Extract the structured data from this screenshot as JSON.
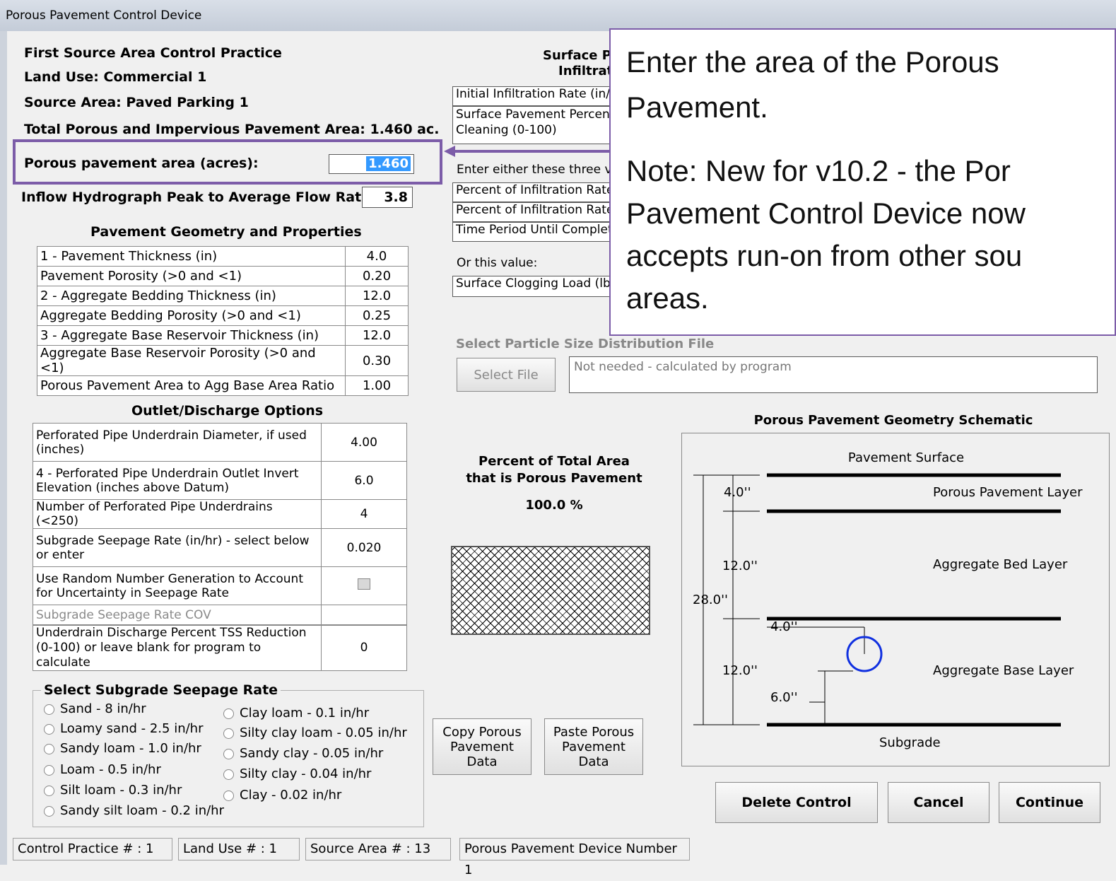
{
  "window": {
    "title": "Porous Pavement Control Device"
  },
  "header": {
    "control_practice": "First Source Area Control Practice",
    "land_use": "Land Use:  Commercial 1",
    "source_area": "Source Area:  Paved Parking 1",
    "total_area": "Total Porous and Impervious Pavement Area:  1.460 ac.",
    "porous_area_label": "Porous pavement area (acres):",
    "porous_area_value": "1.460",
    "inflow_label": "Inflow Hydrograph Peak to Average Flow Ratio",
    "inflow_value": "3.8"
  },
  "geometry": {
    "heading": "Pavement Geometry and Properties",
    "rows": [
      {
        "label": "1 - Pavement Thickness (in)",
        "value": "4.0"
      },
      {
        "label": "Pavement Porosity (>0 and <1)",
        "value": "0.20"
      },
      {
        "label": "2 - Aggregate Bedding Thickness (in)",
        "value": "12.0"
      },
      {
        "label": "Aggregate Bedding Porosity (>0 and <1)",
        "value": "0.25"
      },
      {
        "label": "3 - Aggregate Base Reservoir Thickness (in)",
        "value": "12.0"
      },
      {
        "label": "Aggregate Base Reservoir Porosity  (>0 and <1)",
        "value": "0.30"
      },
      {
        "label": "Porous Pavement Area to Agg Base Area Ratio",
        "value": "1.00"
      }
    ]
  },
  "outlet": {
    "heading": "Outlet/Discharge Options",
    "rows": [
      {
        "label": "Perforated Pipe Underdrain Diameter, if used (inches)",
        "value": "4.00"
      },
      {
        "label": "4 - Perforated Pipe Underdrain Outlet Invert Elevation (inches above Datum)",
        "value": "6.0"
      },
      {
        "label": "Number of Perforated Pipe Underdrains (<250)",
        "value": "4"
      },
      {
        "label": "Subgrade Seepage Rate (in/hr) - select below or enter",
        "value": "0.020"
      },
      {
        "label": "Use Random Number Generation to Account for Uncertainty in Seepage Rate",
        "value": ""
      },
      {
        "label": "Subgrade Seepage Rate COV",
        "value": ""
      }
    ],
    "tss_label": "Underdrain Discharge Percent TSS Reduction (0-100) or leave blank for program to calculate",
    "tss_value": "0"
  },
  "seepage": {
    "heading": "Select Subgrade Seepage Rate",
    "left": [
      "Sand - 8 in/hr",
      "Loamy sand - 2.5 in/hr",
      "Sandy loam - 1.0 in/hr",
      "Loam - 0.5 in/hr",
      "Silt loam - 0.3 in/hr",
      "Sandy silt loam - 0.2 in/hr"
    ],
    "right": [
      "Clay loam - 0.1 in/hr",
      "Silty clay loam - 0.05 in/hr",
      "Sandy clay - 0.05 in/hr",
      "Silty clay - 0.04 in/hr",
      "Clay - 0.02 in/hr"
    ]
  },
  "surface": {
    "heading1": "Surface P",
    "heading2": "Infiltrat",
    "row1": "Initial Infiltration Rate (in/h",
    "row2": "Surface Pavement Percen Cleaning (0-100)",
    "either": "Enter either these three va",
    "e1": "Percent of Infiltration Rate",
    "e2": "Percent of Infiltration Rate",
    "e3": "Time Period Until Complet",
    "or": "Or this value:",
    "clog": "Surface Clogging Load (lb"
  },
  "particle": {
    "heading": "Select Particle Size Distribution File",
    "button": "Select File",
    "file": "Not needed - calculated by program"
  },
  "percent": {
    "line1": "Percent of Total Area",
    "line2": "that is Porous Pavement",
    "value": "100.0 %"
  },
  "copy_button": "Copy Porous Pavement Data",
  "paste_button": "Paste Porous Pavement Data",
  "schematic": {
    "title": "Porous Pavement Geometry  Schematic",
    "surface": "Pavement Surface",
    "layer1": "Porous Pavement Layer",
    "layer2": "Aggregate Bed Layer",
    "layer3": "Aggregate Base Layer",
    "subgrade": "Subgrade",
    "d1": "4.0''",
    "d2": "12.0''",
    "d3": "12.0''",
    "total": "28.0''",
    "pipe": "4.0''",
    "invert": "6.0''"
  },
  "buttons": {
    "delete": "Delete Control",
    "cancel": "Cancel",
    "continue": "Continue"
  },
  "status": [
    "Control Practice # :  1",
    "Land Use # :  1",
    "Source Area # :  13",
    "Porous Pavement Device Number 1"
  ],
  "annotation": {
    "line1": "Enter the area of the Porous",
    "line2": "Pavement.",
    "note1": "Note:  New for v10.2 - the Por",
    "note2": "Pavement Control Device now",
    "note3": "accepts run-on from other sou",
    "note4": "areas."
  },
  "colors": {
    "highlight": "#7c5ca8",
    "pipe": "#1030e0",
    "selection": "#3399ff"
  }
}
